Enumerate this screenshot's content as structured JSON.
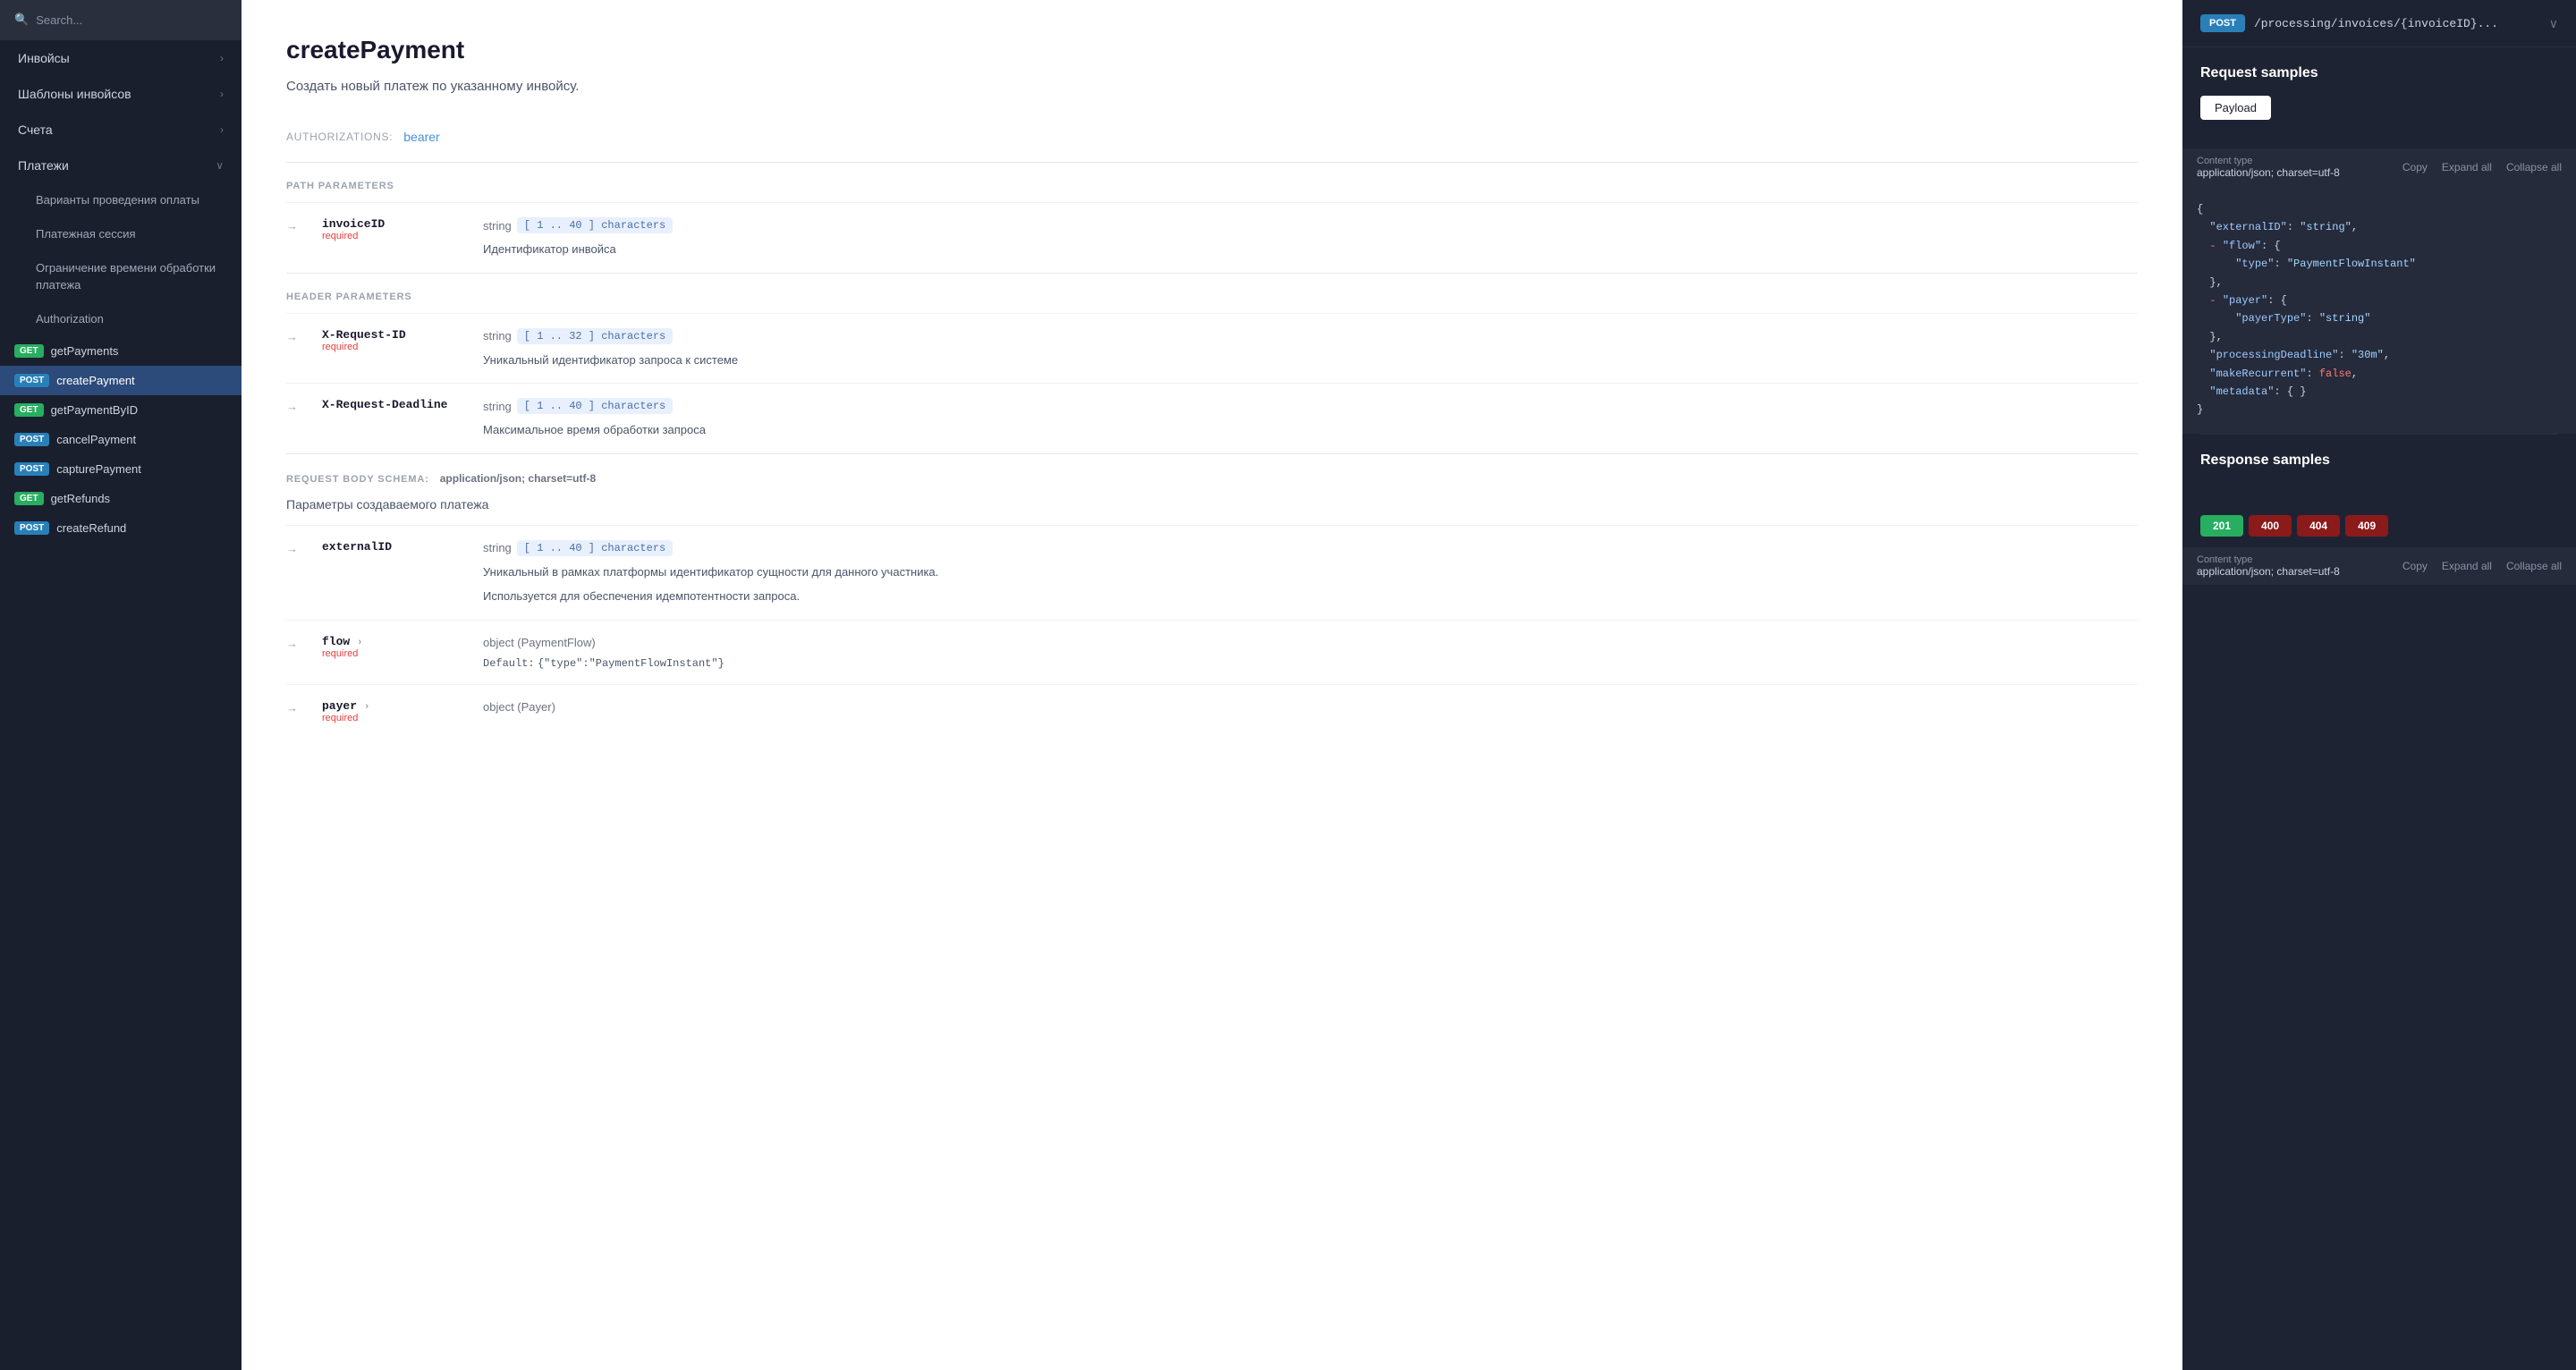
{
  "sidebar": {
    "search_placeholder": "Search...",
    "items": [
      {
        "id": "invoices",
        "label": "Инвойсы",
        "type": "section",
        "hasChevron": true
      },
      {
        "id": "templates",
        "label": "Шаблоны инвойсов",
        "type": "section",
        "hasChevron": true
      },
      {
        "id": "accounts",
        "label": "Счета",
        "type": "section",
        "hasChevron": true
      },
      {
        "id": "payments",
        "label": "Платежи",
        "type": "section",
        "hasChevron": true,
        "expanded": true
      }
    ],
    "sub_items": [
      {
        "id": "variants",
        "label": "Варианты проведения оплаты"
      },
      {
        "id": "session",
        "label": "Платежная сессия"
      },
      {
        "id": "time_limit",
        "label": "Ограничение времени обработки платежа"
      },
      {
        "id": "authorization",
        "label": "Authorization"
      }
    ],
    "endpoints": [
      {
        "id": "getPayments",
        "method": "GET",
        "label": "getPayments",
        "active": false
      },
      {
        "id": "createPayment",
        "method": "POST",
        "label": "createPayment",
        "active": true
      },
      {
        "id": "getPaymentByID",
        "method": "GET",
        "label": "getPaymentByID",
        "active": false
      },
      {
        "id": "cancelPayment",
        "method": "POST",
        "label": "cancelPayment",
        "active": false
      },
      {
        "id": "capturePayment",
        "method": "POST",
        "label": "capturePayment",
        "active": false
      },
      {
        "id": "getRefunds",
        "method": "GET",
        "label": "getRefunds",
        "active": false
      },
      {
        "id": "createRefund",
        "method": "POST",
        "label": "createRefund",
        "active": false
      }
    ]
  },
  "main": {
    "title": "createPayment",
    "description": "Создать новый платеж по указанному инвойсу.",
    "auth_label": "AUTHORIZATIONS:",
    "auth_value": "bearer",
    "sections": {
      "path_params_label": "PATH PARAMETERS",
      "header_params_label": "HEADER PARAMETERS",
      "body_label": "REQUEST BODY SCHEMA:",
      "body_type": "application/json; charset=utf-8",
      "body_desc": "Параметры создаваемого платежа"
    },
    "params": {
      "invoiceID": {
        "name": "invoiceID",
        "required": true,
        "type": "string",
        "constraint": "[ 1 .. 40 ] characters",
        "desc": "Идентификатор инвойса"
      },
      "xRequestID": {
        "name": "X-Request-ID",
        "required": true,
        "type": "string",
        "constraint": "[ 1 .. 32 ] characters",
        "desc": "Уникальный идентификатор запроса к системе"
      },
      "xRequestDeadline": {
        "name": "X-Request-Deadline",
        "required": false,
        "type": "string",
        "constraint": "[ 1 .. 40 ] characters",
        "desc": "Максимальное время обработки запроса"
      },
      "externalID": {
        "name": "externalID",
        "required": false,
        "type": "string",
        "constraint": "[ 1 .. 40 ] characters",
        "desc1": "Уникальный в рамках платформы идентификатор сущности для данного участника.",
        "desc2": "Используется для обеспечения идемпотентности запроса."
      },
      "flow": {
        "name": "flow",
        "required": true,
        "type": "object (PaymentFlow)",
        "default_label": "Default:",
        "default_value": "{\"type\":\"PaymentFlowInstant\"}"
      },
      "payer": {
        "name": "payer",
        "required": true,
        "type": "object (Payer)"
      }
    }
  },
  "right_panel": {
    "method": "POST",
    "path": "/processing/invoices/{invoiceID}...",
    "request_samples_title": "Request samples",
    "tabs": [
      {
        "id": "payload",
        "label": "Payload",
        "active": true
      }
    ],
    "content_type_label": "Content type",
    "content_type_value": "application/json; charset=utf-8",
    "actions": {
      "copy": "Copy",
      "expand_all": "Expand all",
      "collapse_all": "Collapse all"
    },
    "code": {
      "externalID": "\"string\"",
      "flow_type": "\"PaymentFlowInstant\"",
      "payer_payerType": "\"string\"",
      "processingDeadline": "\"30m\"",
      "makeRecurrent": "false"
    },
    "response_samples_title": "Response samples",
    "response_tabs": [
      {
        "id": "201",
        "label": "201",
        "style": "s201"
      },
      {
        "id": "400",
        "label": "400",
        "style": "s400"
      },
      {
        "id": "404",
        "label": "404",
        "style": "s404"
      },
      {
        "id": "409",
        "label": "409",
        "style": "s409"
      }
    ],
    "response_content_type_label": "Content type",
    "response_content_type_value": "application/json; charset=utf-8",
    "response_actions": {
      "copy": "Copy",
      "expand_all": "Expand all",
      "collapse_all": "Collapse all"
    }
  },
  "icons": {
    "search": "🔍",
    "chevron_right": "›",
    "chevron_down": "∨",
    "arrow": "→"
  }
}
